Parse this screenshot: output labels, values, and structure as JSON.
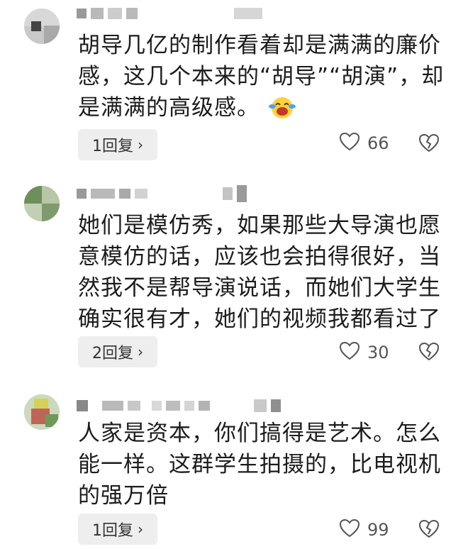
{
  "comments": [
    {
      "content": "胡导几亿的制作看着却是满满的廉价感，这几个本来的“胡导”“胡演”，却是满满的高级感。",
      "reply_label": "1回复",
      "reply_chevron": "›",
      "like_count": "66",
      "emoji": "laughing-crying-emoji"
    },
    {
      "content": "她们是模仿秀，如果那些大导演也愿意模仿的话，应该也会拍得很好，当然我不是帮导演说话，而她们大学生确实很有才，她们的视频我都看过了",
      "reply_label": "2回复",
      "reply_chevron": "›",
      "like_count": "30"
    },
    {
      "content": "人家是资本，你们搞得是艺术。怎么能一样。这群学生拍摄的，比电视机的强万倍",
      "reply_label": "1回复",
      "reply_chevron": "›",
      "like_count": "99"
    }
  ],
  "icons": {
    "like": "heart-outline-icon",
    "dislike": "broken-heart-icon"
  },
  "colors": {
    "reply_bg": "#eeeeee",
    "text": "#1c1c1c",
    "icon": "#555555"
  }
}
